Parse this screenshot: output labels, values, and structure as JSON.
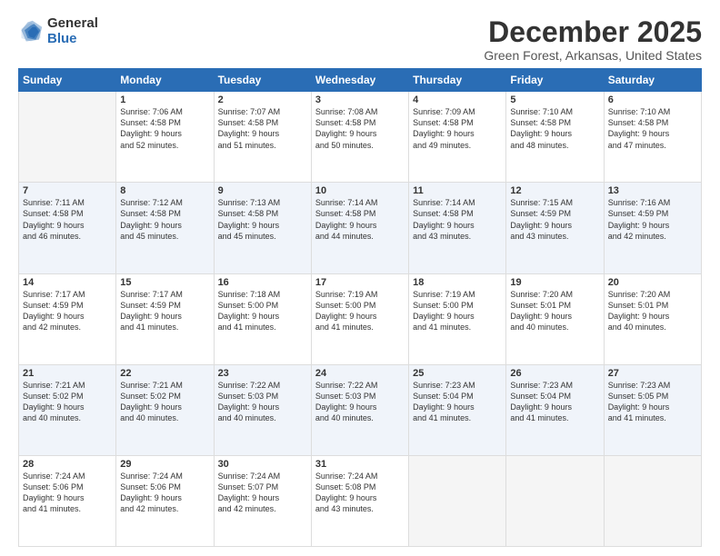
{
  "logo": {
    "general": "General",
    "blue": "Blue"
  },
  "header": {
    "month": "December 2025",
    "location": "Green Forest, Arkansas, United States"
  },
  "weekdays": [
    "Sunday",
    "Monday",
    "Tuesday",
    "Wednesday",
    "Thursday",
    "Friday",
    "Saturday"
  ],
  "weeks": [
    [
      {
        "day": "",
        "info": ""
      },
      {
        "day": "1",
        "info": "Sunrise: 7:06 AM\nSunset: 4:58 PM\nDaylight: 9 hours\nand 52 minutes."
      },
      {
        "day": "2",
        "info": "Sunrise: 7:07 AM\nSunset: 4:58 PM\nDaylight: 9 hours\nand 51 minutes."
      },
      {
        "day": "3",
        "info": "Sunrise: 7:08 AM\nSunset: 4:58 PM\nDaylight: 9 hours\nand 50 minutes."
      },
      {
        "day": "4",
        "info": "Sunrise: 7:09 AM\nSunset: 4:58 PM\nDaylight: 9 hours\nand 49 minutes."
      },
      {
        "day": "5",
        "info": "Sunrise: 7:10 AM\nSunset: 4:58 PM\nDaylight: 9 hours\nand 48 minutes."
      },
      {
        "day": "6",
        "info": "Sunrise: 7:10 AM\nSunset: 4:58 PM\nDaylight: 9 hours\nand 47 minutes."
      }
    ],
    [
      {
        "day": "7",
        "info": "Sunrise: 7:11 AM\nSunset: 4:58 PM\nDaylight: 9 hours\nand 46 minutes."
      },
      {
        "day": "8",
        "info": "Sunrise: 7:12 AM\nSunset: 4:58 PM\nDaylight: 9 hours\nand 45 minutes."
      },
      {
        "day": "9",
        "info": "Sunrise: 7:13 AM\nSunset: 4:58 PM\nDaylight: 9 hours\nand 45 minutes."
      },
      {
        "day": "10",
        "info": "Sunrise: 7:14 AM\nSunset: 4:58 PM\nDaylight: 9 hours\nand 44 minutes."
      },
      {
        "day": "11",
        "info": "Sunrise: 7:14 AM\nSunset: 4:58 PM\nDaylight: 9 hours\nand 43 minutes."
      },
      {
        "day": "12",
        "info": "Sunrise: 7:15 AM\nSunset: 4:59 PM\nDaylight: 9 hours\nand 43 minutes."
      },
      {
        "day": "13",
        "info": "Sunrise: 7:16 AM\nSunset: 4:59 PM\nDaylight: 9 hours\nand 42 minutes."
      }
    ],
    [
      {
        "day": "14",
        "info": "Sunrise: 7:17 AM\nSunset: 4:59 PM\nDaylight: 9 hours\nand 42 minutes."
      },
      {
        "day": "15",
        "info": "Sunrise: 7:17 AM\nSunset: 4:59 PM\nDaylight: 9 hours\nand 41 minutes."
      },
      {
        "day": "16",
        "info": "Sunrise: 7:18 AM\nSunset: 5:00 PM\nDaylight: 9 hours\nand 41 minutes."
      },
      {
        "day": "17",
        "info": "Sunrise: 7:19 AM\nSunset: 5:00 PM\nDaylight: 9 hours\nand 41 minutes."
      },
      {
        "day": "18",
        "info": "Sunrise: 7:19 AM\nSunset: 5:00 PM\nDaylight: 9 hours\nand 41 minutes."
      },
      {
        "day": "19",
        "info": "Sunrise: 7:20 AM\nSunset: 5:01 PM\nDaylight: 9 hours\nand 40 minutes."
      },
      {
        "day": "20",
        "info": "Sunrise: 7:20 AM\nSunset: 5:01 PM\nDaylight: 9 hours\nand 40 minutes."
      }
    ],
    [
      {
        "day": "21",
        "info": "Sunrise: 7:21 AM\nSunset: 5:02 PM\nDaylight: 9 hours\nand 40 minutes."
      },
      {
        "day": "22",
        "info": "Sunrise: 7:21 AM\nSunset: 5:02 PM\nDaylight: 9 hours\nand 40 minutes."
      },
      {
        "day": "23",
        "info": "Sunrise: 7:22 AM\nSunset: 5:03 PM\nDaylight: 9 hours\nand 40 minutes."
      },
      {
        "day": "24",
        "info": "Sunrise: 7:22 AM\nSunset: 5:03 PM\nDaylight: 9 hours\nand 40 minutes."
      },
      {
        "day": "25",
        "info": "Sunrise: 7:23 AM\nSunset: 5:04 PM\nDaylight: 9 hours\nand 41 minutes."
      },
      {
        "day": "26",
        "info": "Sunrise: 7:23 AM\nSunset: 5:04 PM\nDaylight: 9 hours\nand 41 minutes."
      },
      {
        "day": "27",
        "info": "Sunrise: 7:23 AM\nSunset: 5:05 PM\nDaylight: 9 hours\nand 41 minutes."
      }
    ],
    [
      {
        "day": "28",
        "info": "Sunrise: 7:24 AM\nSunset: 5:06 PM\nDaylight: 9 hours\nand 41 minutes."
      },
      {
        "day": "29",
        "info": "Sunrise: 7:24 AM\nSunset: 5:06 PM\nDaylight: 9 hours\nand 42 minutes."
      },
      {
        "day": "30",
        "info": "Sunrise: 7:24 AM\nSunset: 5:07 PM\nDaylight: 9 hours\nand 42 minutes."
      },
      {
        "day": "31",
        "info": "Sunrise: 7:24 AM\nSunset: 5:08 PM\nDaylight: 9 hours\nand 43 minutes."
      },
      {
        "day": "",
        "info": ""
      },
      {
        "day": "",
        "info": ""
      },
      {
        "day": "",
        "info": ""
      }
    ]
  ]
}
